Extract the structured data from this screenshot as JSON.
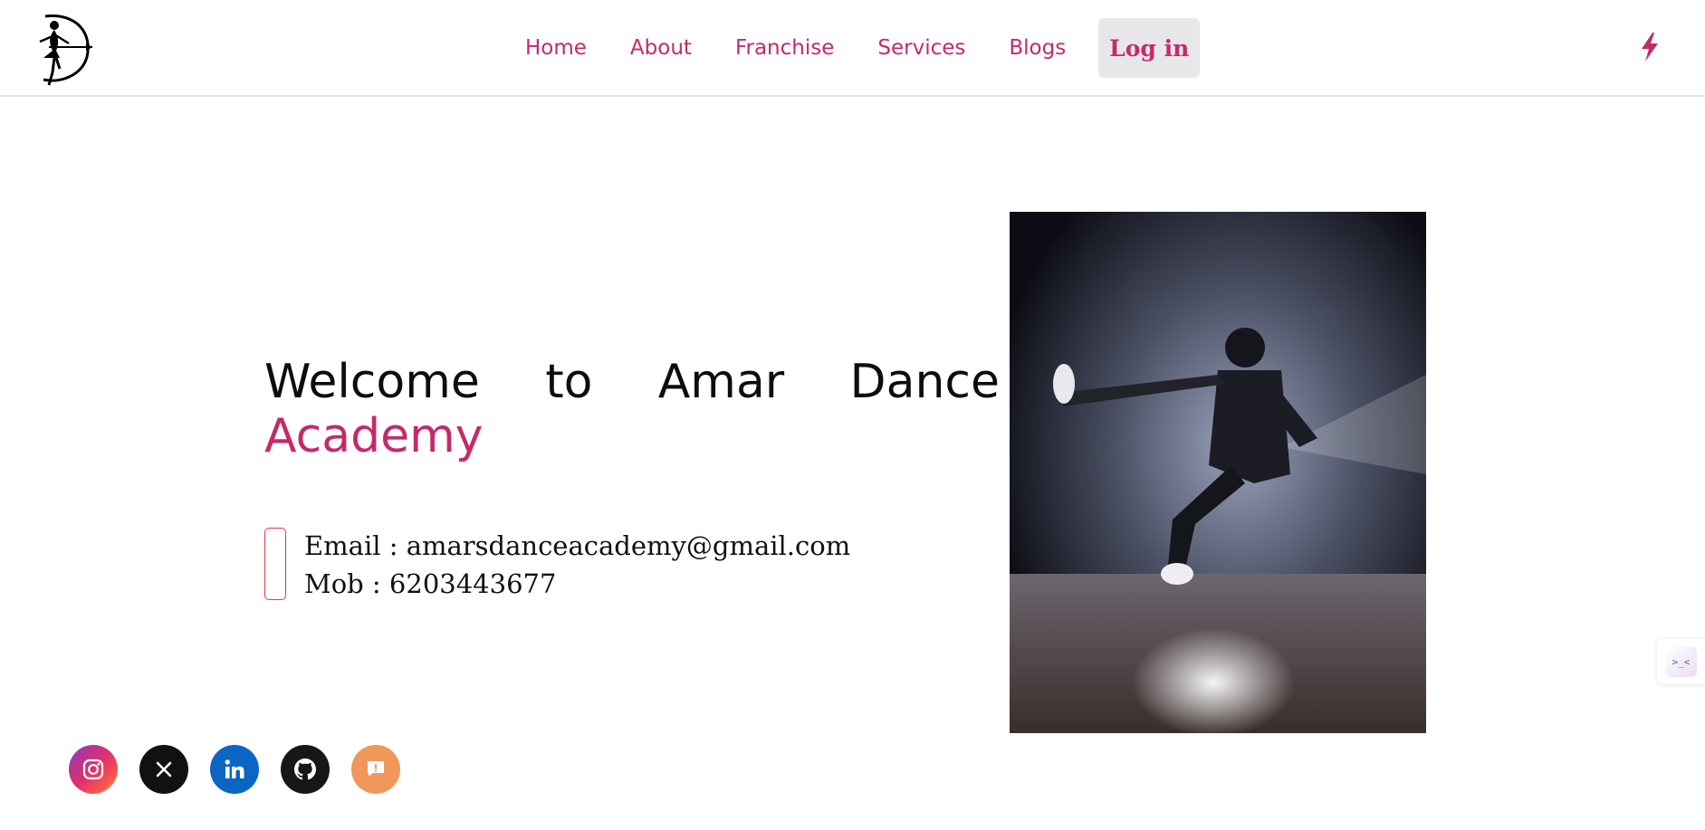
{
  "brand": {
    "accent": "#c42a6b",
    "login_bg": "#e7e7ea"
  },
  "nav": {
    "links": [
      "Home",
      "About",
      "Franchise",
      "Services",
      "Blogs"
    ],
    "login_label": "Log in"
  },
  "hero": {
    "title_words": [
      "Welcome",
      "to",
      "Amar",
      "Dance"
    ],
    "title_accent": "Academy",
    "email_line": "Email : amarsdanceacademy@gmail.com",
    "mob_line": "Mob : 6203443677"
  },
  "social": {
    "icons": [
      "instagram-icon",
      "x-icon",
      "linkedin-icon",
      "github-icon",
      "feedback-icon"
    ]
  },
  "widget": {
    "glyph": ">_<"
  }
}
